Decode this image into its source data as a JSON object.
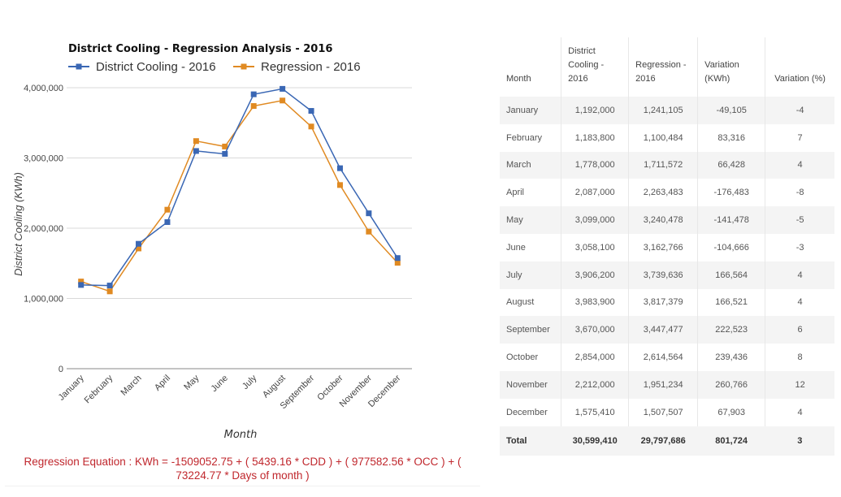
{
  "chart_data": {
    "type": "line",
    "title": "District Cooling - Regression Analysis - 2016",
    "xlabel": "Month",
    "ylabel": "District Cooling (KWh)",
    "ylim": [
      0,
      4000000
    ],
    "yticks": [
      0,
      1000000,
      2000000,
      3000000,
      4000000
    ],
    "ytick_labels": [
      "0",
      "1,000,000",
      "2,000,000",
      "3,000,000",
      "4,000,000"
    ],
    "grid": true,
    "legend_position": "top-left",
    "categories": [
      "January",
      "February",
      "March",
      "April",
      "May",
      "June",
      "July",
      "August",
      "September",
      "October",
      "November",
      "December"
    ],
    "series": [
      {
        "name": "District Cooling - 2016",
        "color": "#3a67b4",
        "values": [
          1192000,
          1183800,
          1778000,
          2087000,
          3099000,
          3058100,
          3906200,
          3983900,
          3670000,
          2854000,
          2212000,
          1575410
        ]
      },
      {
        "name": "Regression - 2016",
        "color": "#e08a22",
        "values": [
          1241105,
          1100484,
          1711572,
          2263483,
          3240478,
          3162766,
          3739636,
          3817379,
          3447477,
          2614564,
          1951234,
          1507507
        ]
      }
    ]
  },
  "equation": {
    "text": "Regression Equation : KWh = -1509052.75 + ( 5439.16 * CDD ) + ( 977582.56 * OCC ) + ( 73224.77 * Days of month )",
    "color": "#c0272d"
  },
  "table": {
    "headers": [
      "Month",
      "District Cooling - 2016",
      "Regression - 2016",
      "Variation (KWh)",
      "Variation (%)"
    ],
    "rows": [
      [
        "January",
        "1,192,000",
        "1,241,105",
        "-49,105",
        "-4"
      ],
      [
        "February",
        "1,183,800",
        "1,100,484",
        "83,316",
        "7"
      ],
      [
        "March",
        "1,778,000",
        "1,711,572",
        "66,428",
        "4"
      ],
      [
        "April",
        "2,087,000",
        "2,263,483",
        "-176,483",
        "-8"
      ],
      [
        "May",
        "3,099,000",
        "3,240,478",
        "-141,478",
        "-5"
      ],
      [
        "June",
        "3,058,100",
        "3,162,766",
        "-104,666",
        "-3"
      ],
      [
        "July",
        "3,906,200",
        "3,739,636",
        "166,564",
        "4"
      ],
      [
        "August",
        "3,983,900",
        "3,817,379",
        "166,521",
        "4"
      ],
      [
        "September",
        "3,670,000",
        "3,447,477",
        "222,523",
        "6"
      ],
      [
        "October",
        "2,854,000",
        "2,614,564",
        "239,436",
        "8"
      ],
      [
        "November",
        "2,212,000",
        "1,951,234",
        "260,766",
        "12"
      ],
      [
        "December",
        "1,575,410",
        "1,507,507",
        "67,903",
        "4"
      ]
    ],
    "total": [
      "Total",
      "30,599,410",
      "29,797,686",
      "801,724",
      "3"
    ]
  }
}
